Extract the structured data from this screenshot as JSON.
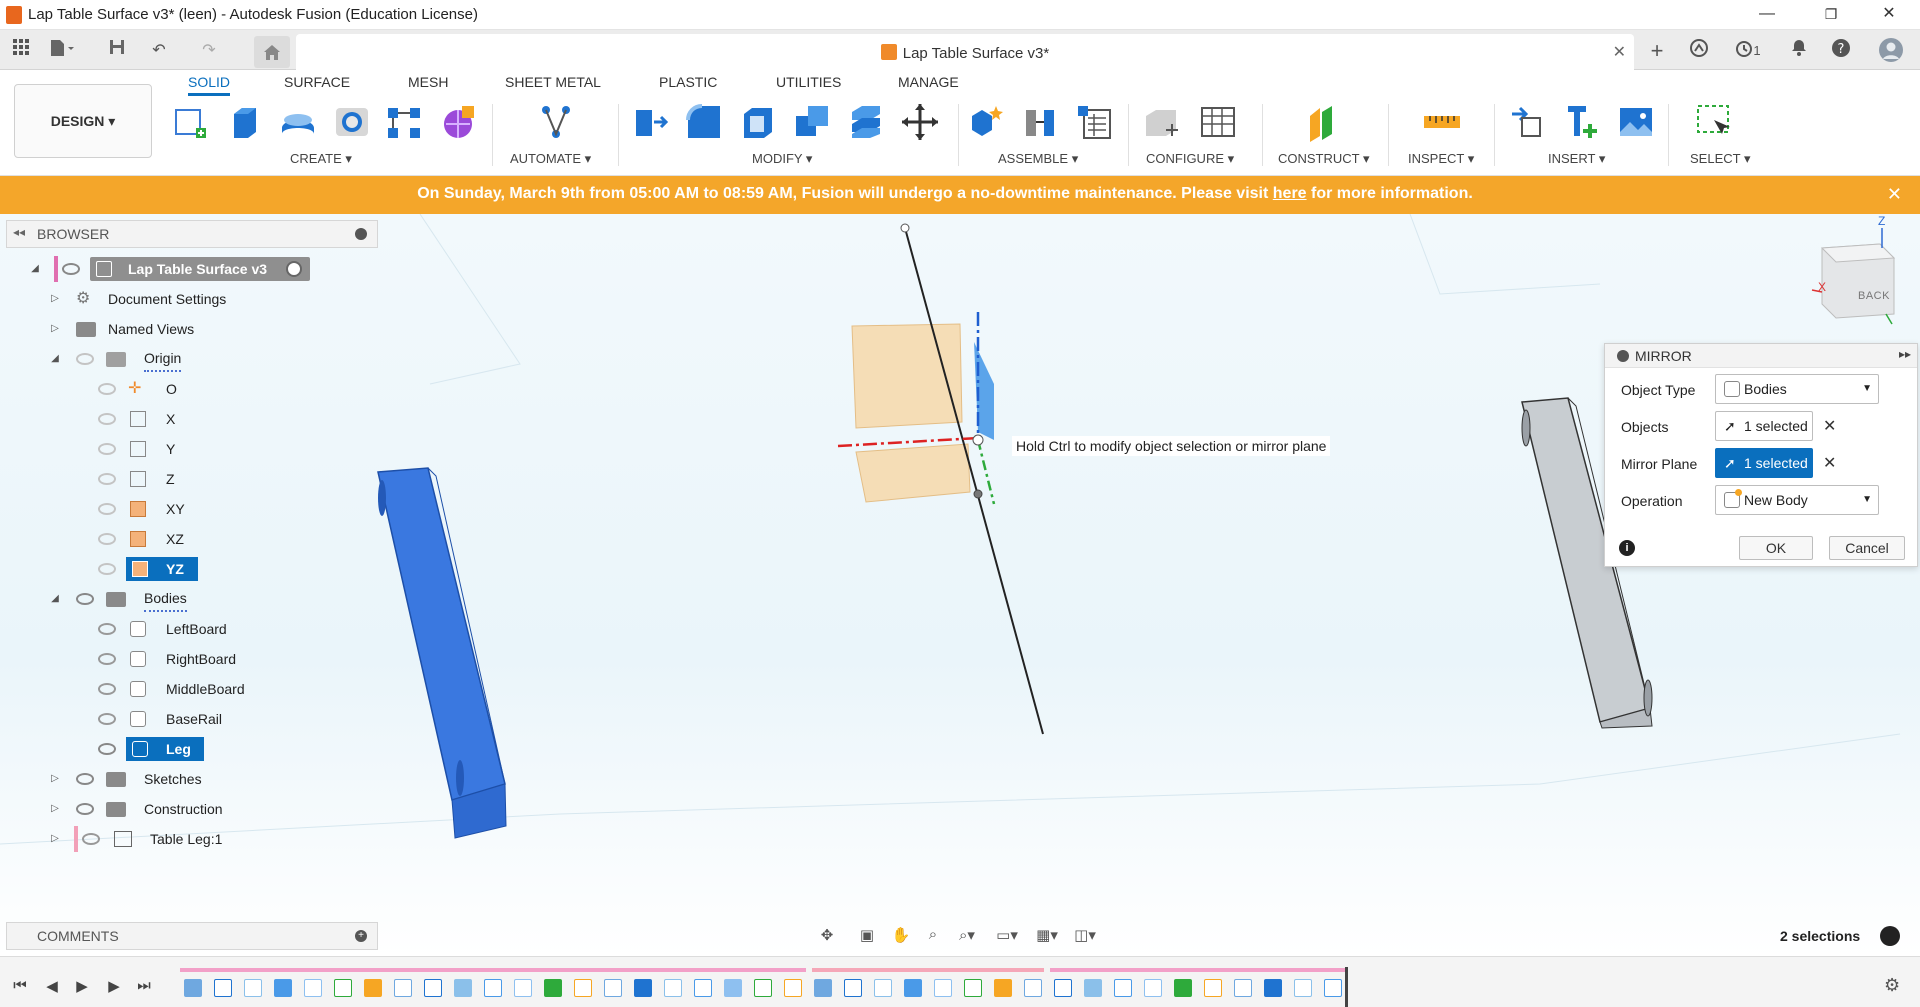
{
  "window": {
    "title": "Lap Table Surface v3* (leen) - Autodesk Fusion (Education License)",
    "minimize": "—",
    "restore": "❐",
    "close": "✕"
  },
  "doc_tab": {
    "label": "Lap Table Surface v3*",
    "close": "✕",
    "jobs_count": "1"
  },
  "toolbar": {
    "workspace": "DESIGN ▾",
    "tabs": [
      "SOLID",
      "SURFACE",
      "MESH",
      "SHEET METAL",
      "PLASTIC",
      "UTILITIES",
      "MANAGE"
    ],
    "groups": [
      "CREATE ▾",
      "AUTOMATE ▾",
      "MODIFY ▾",
      "ASSEMBLE ▾",
      "CONFIGURE ▾",
      "CONSTRUCT ▾",
      "INSPECT ▾",
      "INSERT ▾",
      "SELECT ▾"
    ]
  },
  "banner": {
    "text_before": "On Sunday, March 9th from 05:00 AM to 08:59 AM, Fusion will undergo a no-downtime maintenance. Please visit ",
    "link": "here",
    "text_after": " for more information.",
    "close": "✕"
  },
  "browser": {
    "title": "BROWSER",
    "root": "Lap Table Surface v3",
    "items": {
      "document_settings": "Document Settings",
      "named_views": "Named Views",
      "origin": "Origin",
      "origin_children": [
        "O",
        "X",
        "Y",
        "Z",
        "XY",
        "XZ",
        "YZ"
      ],
      "bodies": "Bodies",
      "bodies_children": [
        "LeftBoard",
        "RightBoard",
        "MiddleBoard",
        "BaseRail",
        "Leg"
      ],
      "sketches": "Sketches",
      "construction": "Construction",
      "component": "Table Leg:1"
    }
  },
  "viewport": {
    "hint": "Hold Ctrl to modify object selection or mirror plane",
    "viewcube_face": "BACK",
    "axis_x": "X",
    "axis_z": "Z"
  },
  "mirror_dialog": {
    "title": "MIRROR",
    "object_type_label": "Object Type",
    "object_type_value": "Bodies",
    "objects_label": "Objects",
    "objects_value": "1 selected",
    "mirror_plane_label": "Mirror Plane",
    "mirror_plane_value": "1 selected",
    "operation_label": "Operation",
    "operation_value": "New Body",
    "ok": "OK",
    "cancel": "Cancel"
  },
  "comments": {
    "title": "COMMENTS"
  },
  "status": {
    "selections": "2 selections"
  },
  "colors": {
    "accent": "#0a6fbe",
    "banner": "#f4a62a",
    "selected_body": "#2f6fd6",
    "timeline_pink": "#f2a0c8"
  }
}
